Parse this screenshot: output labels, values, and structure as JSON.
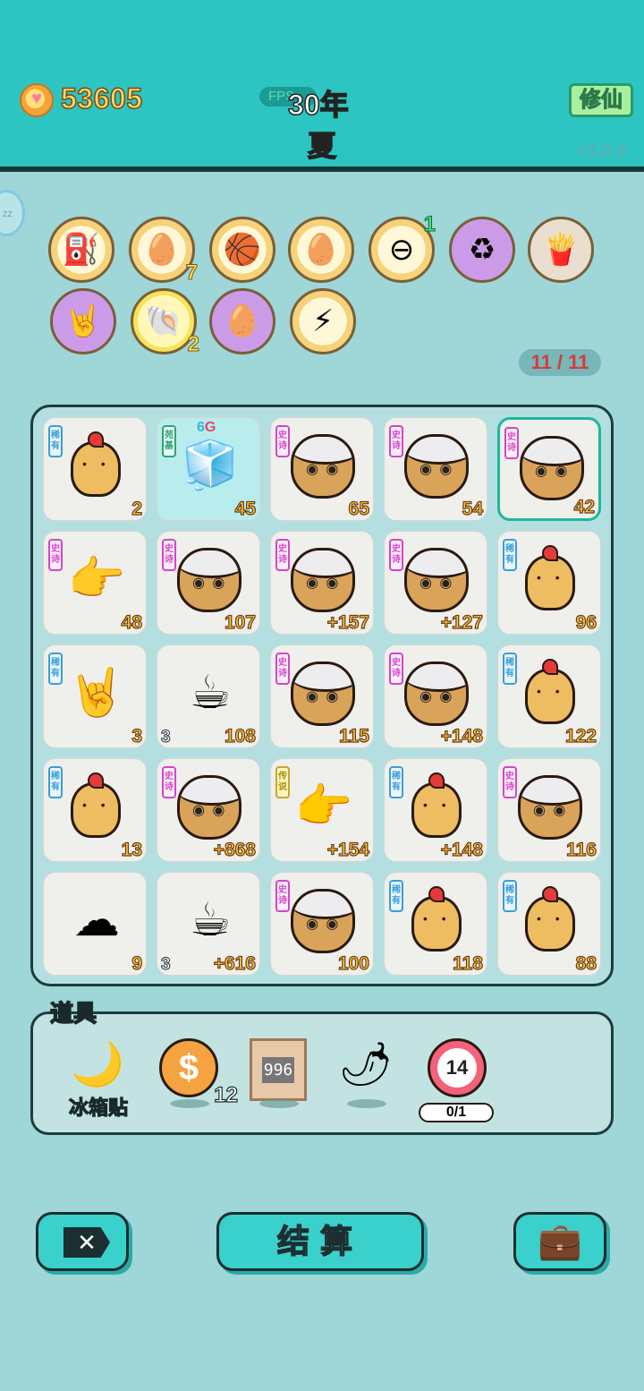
{
  "header": {
    "coins": "53605",
    "fps_label": "FPS",
    "year": "30年",
    "season": "夏",
    "cultivate_button": "修仙",
    "version": "v3.0.9",
    "side_bubble": "zz"
  },
  "buffs": [
    {
      "name": "pump-icon",
      "glyph": "⛽",
      "style": "gold",
      "badge": ""
    },
    {
      "name": "egg-tray-icon",
      "glyph": "🥚",
      "style": "gold",
      "badge": "7"
    },
    {
      "name": "basketballs-icon",
      "glyph": "🏀",
      "style": "gold",
      "badge": ""
    },
    {
      "name": "egg-bag-icon",
      "glyph": "🥚",
      "style": "gold",
      "badge": ""
    },
    {
      "name": "minus-icon",
      "glyph": "⊖",
      "style": "gold",
      "badge": "1"
    },
    {
      "name": "recycle-icon",
      "glyph": "♻",
      "style": "purple",
      "badge": ""
    },
    {
      "name": "fries-icon",
      "glyph": "🍟",
      "style": "beige",
      "badge": ""
    },
    {
      "name": "rock-hand-icon",
      "glyph": "🤘",
      "style": "purple",
      "badge": ""
    },
    {
      "name": "shell-icon",
      "glyph": "🐚",
      "style": "yellow",
      "badge": "2"
    },
    {
      "name": "egg-icon",
      "glyph": "🥚",
      "style": "purple",
      "badge": ""
    },
    {
      "name": "lightning-icon",
      "glyph": "⚡",
      "style": "gold",
      "badge": ""
    }
  ],
  "slot_counter": "11 / 11",
  "board": [
    {
      "tag": "稀有",
      "tag_type": "rare",
      "kind": "chick",
      "num": "2",
      "left_num": ""
    },
    {
      "tag": "苑基",
      "tag_type": "green",
      "kind": "fridge",
      "num": "45",
      "left_num": "",
      "extra": "6",
      "extra2": "G"
    },
    {
      "tag": "史诗",
      "tag_type": "epic",
      "kind": "hair",
      "num": "65",
      "left_num": ""
    },
    {
      "tag": "史诗",
      "tag_type": "epic",
      "kind": "hair",
      "num": "54",
      "left_num": ""
    },
    {
      "tag": "史诗",
      "tag_type": "epic",
      "kind": "hair",
      "num": "42",
      "left_num": "",
      "selected": true
    },
    {
      "tag": "史诗",
      "tag_type": "epic",
      "kind": "hand",
      "num": "48",
      "left_num": ""
    },
    {
      "tag": "史诗",
      "tag_type": "epic",
      "kind": "hair",
      "num": "107",
      "left_num": ""
    },
    {
      "tag": "史诗",
      "tag_type": "epic",
      "kind": "hair",
      "num": "+157",
      "left_num": ""
    },
    {
      "tag": "史诗",
      "tag_type": "epic",
      "kind": "hair",
      "num": "+127",
      "left_num": ""
    },
    {
      "tag": "稀有",
      "tag_type": "rare",
      "kind": "chick",
      "num": "96",
      "left_num": ""
    },
    {
      "tag": "稀有",
      "tag_type": "rare",
      "kind": "rock",
      "num": "3",
      "left_num": ""
    },
    {
      "tag": "",
      "tag_type": "",
      "kind": "coffee",
      "num": "108",
      "left_num": "3"
    },
    {
      "tag": "史诗",
      "tag_type": "epic",
      "kind": "hair",
      "num": "115",
      "left_num": ""
    },
    {
      "tag": "史诗",
      "tag_type": "epic",
      "kind": "hair",
      "num": "+148",
      "left_num": ""
    },
    {
      "tag": "稀有",
      "tag_type": "rare",
      "kind": "chick",
      "num": "122",
      "left_num": ""
    },
    {
      "tag": "稀有",
      "tag_type": "rare",
      "kind": "chick",
      "num": "13",
      "left_num": ""
    },
    {
      "tag": "史诗",
      "tag_type": "epic",
      "kind": "hair",
      "num": "+868",
      "left_num": ""
    },
    {
      "tag": "传说",
      "tag_type": "legend",
      "kind": "yhand",
      "num": "+154",
      "left_num": ""
    },
    {
      "tag": "稀有",
      "tag_type": "rare",
      "kind": "chick",
      "num": "+148",
      "left_num": ""
    },
    {
      "tag": "史诗",
      "tag_type": "epic",
      "kind": "hair",
      "num": "116",
      "left_num": ""
    },
    {
      "tag": "",
      "tag_type": "",
      "kind": "cloud",
      "num": "9",
      "left_num": ""
    },
    {
      "tag": "",
      "tag_type": "",
      "kind": "coffee",
      "num": "+616",
      "left_num": "3"
    },
    {
      "tag": "史诗",
      "tag_type": "epic",
      "kind": "hair",
      "num": "100",
      "left_num": ""
    },
    {
      "tag": "稀有",
      "tag_type": "rare",
      "kind": "chick",
      "num": "118",
      "left_num": ""
    },
    {
      "tag": "稀有",
      "tag_type": "rare",
      "kind": "chick",
      "num": "88",
      "left_num": ""
    }
  ],
  "tools": {
    "title": "道具",
    "fridge_sticker_label": "冰箱贴",
    "coin_count": "12",
    "counter_digits": "996",
    "target_value": "14",
    "target_progress": "0/1"
  },
  "bottom": {
    "close_glyph": "✕",
    "settle_label": "结算",
    "bag_glyph": "💼"
  },
  "colors": {
    "top_bar": "#2cc5c2",
    "background": "#9fd6d8",
    "counter_text": "#d83a3a"
  }
}
